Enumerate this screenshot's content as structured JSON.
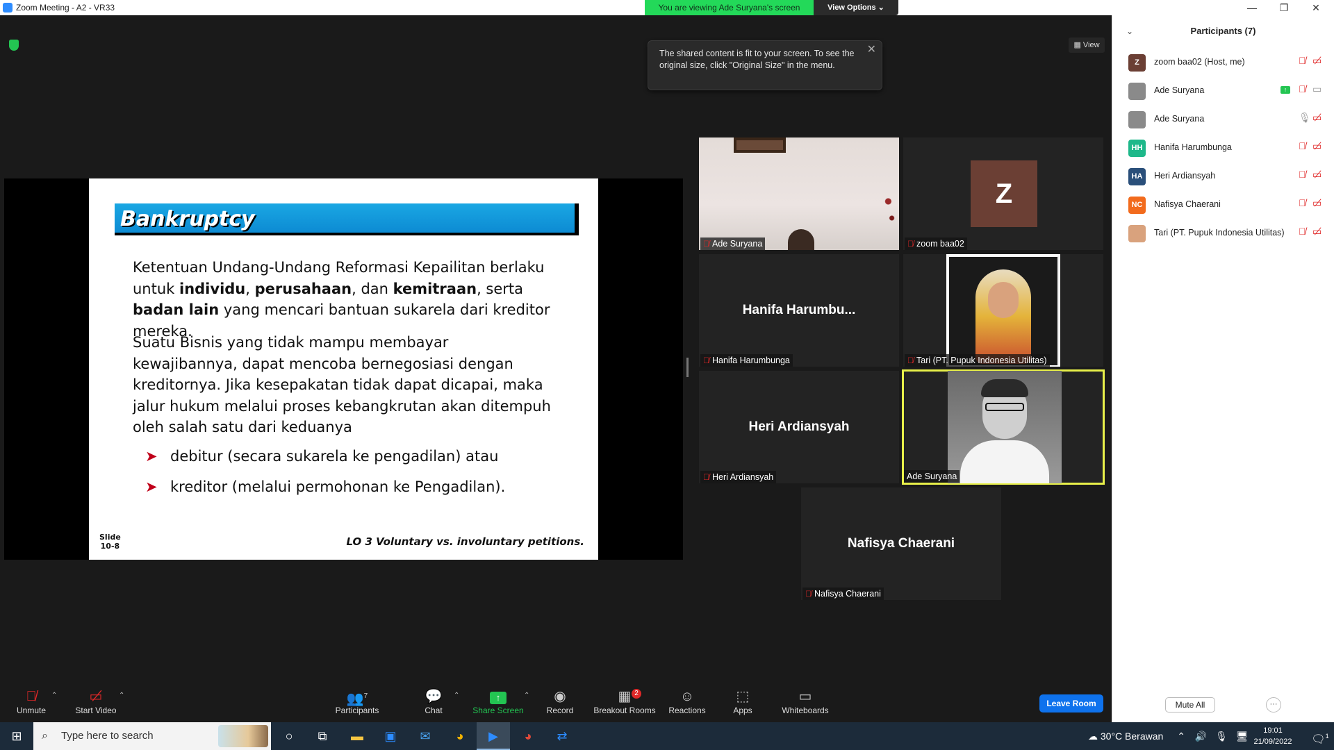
{
  "window": {
    "title": "Zoom Meeting - A2 - VR33",
    "viewing_banner": "You are viewing Ade Suryana's screen",
    "view_options": "View Options ⌄",
    "view_button": "View"
  },
  "tooltip": {
    "text": "The shared content is fit to your screen. To see the original size, click \"Original Size\" in the menu."
  },
  "slide": {
    "title": "Bankruptcy",
    "para1_a": "Ketentuan Undang-Undang Reformasi Kepailitan berlaku untuk ",
    "para1_b1": "individu",
    "para1_sep1": ", ",
    "para1_b2": "perusahaan",
    "para1_sep2": ", dan ",
    "para1_b3": "kemitraan",
    "para1_sep3": ", serta ",
    "para1_b4": "badan lain",
    "para1_c": " yang mencari bantuan sukarela dari kreditor mereka.",
    "para2": "Suatu Bisnis yang tidak mampu membayar kewajibannya, dapat mencoba bernegosiasi dengan kreditornya. Jika kesepakatan tidak dapat dicapai, maka jalur hukum melalui proses kebangkrutan akan ditempuh oleh salah satu dari keduanya",
    "bullets": [
      "debitur (secara sukarela ke pengadilan) atau",
      "kreditor (melalui permohonan ke Pengadilan)."
    ],
    "bullet_marker": "➤",
    "slide_number_label": "Slide",
    "slide_number": "10-8",
    "footer": "LO 3  Voluntary vs. involuntary petitions."
  },
  "gallery": [
    {
      "name": "Ade Suryana",
      "center": "",
      "kind": "video"
    },
    {
      "name": "zoom baa02",
      "center": "Z",
      "kind": "avatar"
    },
    {
      "name": "Hanifa Harumbunga",
      "center": "Hanifa  Harumbu...",
      "kind": "name"
    },
    {
      "name": "Tari (PT. Pupuk Indonesia Utilitas)",
      "center": "",
      "kind": "video"
    },
    {
      "name": "Heri Ardiansyah",
      "center": "Heri Ardiansyah",
      "kind": "name"
    },
    {
      "name": "Ade Suryana",
      "center": "",
      "kind": "video-active"
    },
    {
      "name": "Nafisya Chaerani",
      "center": "Nafisya Chaerani",
      "kind": "name"
    }
  ],
  "participants_panel": {
    "title": "Participants (7)",
    "mute_all": "Mute All",
    "more": "···",
    "items": [
      {
        "initials": "Z",
        "color": "#6b3f34",
        "name": "zoom baa02 (Host, me)",
        "mic": "muted",
        "cam": "off"
      },
      {
        "initials": "",
        "color": "#8a8a8a",
        "name": "Ade Suryana",
        "mic": "muted",
        "cam": "on",
        "sharing": true
      },
      {
        "initials": "",
        "color": "#8a8a8a",
        "name": "Ade Suryana",
        "mic": "on",
        "cam": "off"
      },
      {
        "initials": "HH",
        "color": "#1eb88a",
        "name": "Hanifa Harumbunga",
        "mic": "muted",
        "cam": "off"
      },
      {
        "initials": "HA",
        "color": "#2a4f7a",
        "name": "Heri Ardiansyah",
        "mic": "muted",
        "cam": "off"
      },
      {
        "initials": "NC",
        "color": "#f26b1d",
        "name": "Nafisya Chaerani",
        "mic": "muted",
        "cam": "off"
      },
      {
        "initials": "",
        "color": "#d9a27d",
        "name": "Tari (PT. Pupuk Indonesia Utilitas)",
        "mic": "muted",
        "cam": "off"
      }
    ]
  },
  "toolbar": {
    "unmute": "Unmute",
    "start_video": "Start Video",
    "participants": "Participants",
    "participants_count": "7",
    "chat": "Chat",
    "share_screen": "Share Screen",
    "record": "Record",
    "breakout_rooms": "Breakout Rooms",
    "breakout_badge": "2",
    "reactions": "Reactions",
    "apps": "Apps",
    "whiteboards": "Whiteboards",
    "leave_room": "Leave Room"
  },
  "taskbar": {
    "search_placeholder": "Type here to search",
    "weather": "30°C  Berawan",
    "time": "19:01",
    "date": "21/09/2022",
    "notification_count": "1"
  }
}
